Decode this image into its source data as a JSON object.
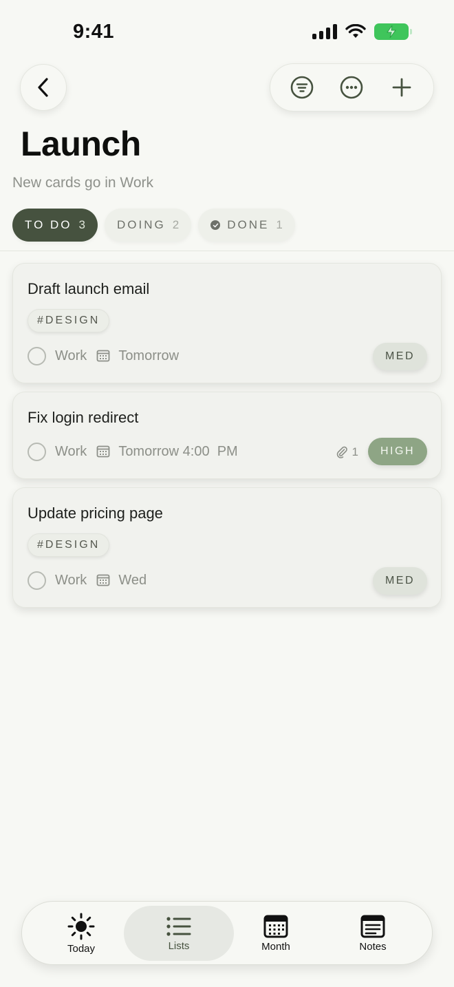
{
  "status_bar": {
    "time": "9:41"
  },
  "header": {
    "title": "Launch",
    "subtitle": "New cards go in Work"
  },
  "tabs": [
    {
      "label": "TO DO",
      "count": "3",
      "active": true
    },
    {
      "label": "DOING",
      "count": "2",
      "active": false
    },
    {
      "label": "DONE",
      "count": "1",
      "active": false
    }
  ],
  "cards": [
    {
      "title": "Draft launch email",
      "tag": "#DESIGN",
      "list": "Work",
      "due": "Tomorrow",
      "priority": "MED"
    },
    {
      "title": "Fix login redirect",
      "list": "Work",
      "due": "Tomorrow 4:00  PM",
      "attachments": "1",
      "priority": "HIGH"
    },
    {
      "title": "Update pricing page",
      "tag": "#DESIGN",
      "list": "Work",
      "due": "Wed",
      "priority": "MED"
    }
  ],
  "bottom_nav": [
    {
      "label": "Today",
      "icon": "sun-icon"
    },
    {
      "label": "Lists",
      "icon": "list-icon",
      "active": true
    },
    {
      "label": "Month",
      "icon": "calendar-month-icon"
    },
    {
      "label": "Notes",
      "icon": "notes-icon"
    }
  ],
  "colors": {
    "background": "#f7f8f4",
    "accent_dark": "#46523f",
    "high_priority": "#8ea585",
    "battery": "#3fc55b"
  }
}
